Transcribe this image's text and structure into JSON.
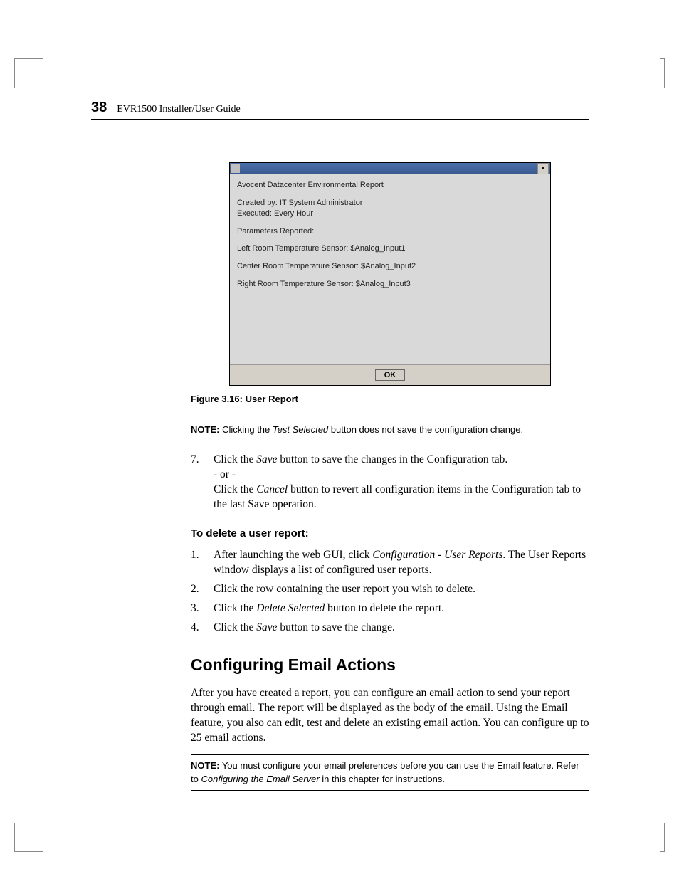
{
  "header": {
    "page_number": "38",
    "doc_title": "EVR1500 Installer/User Guide"
  },
  "figure": {
    "close_glyph": "×",
    "lines": {
      "l1": "Avocent Datacenter Environmental Report",
      "l2": "Created by:  IT System Administrator",
      "l3": "Executed:  Every Hour",
      "l4": "Parameters Reported:",
      "l5": "Left Room Temperature Sensor: $Analog_Input1",
      "l6": "Center Room Temperature Sensor: $Analog_Input2",
      "l7": "Right Room Temperature Sensor: $Analog_Input3"
    },
    "ok_label": "OK",
    "caption": "Figure 3.16: User Report"
  },
  "note1": {
    "label": "NOTE:",
    "before": " Clicking the ",
    "em": "Test Selected",
    "after": " button does not save the configuration change."
  },
  "step7": {
    "num": "7.",
    "a1": "Click the ",
    "a_em": "Save",
    "a2": " button to save the changes in the Configuration tab.",
    "or": "- or -",
    "b1": "Click the ",
    "b_em": "Cancel",
    "b2": " button to revert all configuration items in the Configuration tab to the last Save operation."
  },
  "delete": {
    "heading": "To delete a user report:",
    "s1": {
      "num": "1.",
      "a": "After launching the web GUI, click ",
      "em": "Configuration - User Reports",
      "b": ". The User Reports window displays a list of configured user reports."
    },
    "s2": {
      "num": "2.",
      "a": "Click the row containing the user report you wish to delete."
    },
    "s3": {
      "num": "3.",
      "a": "Click the ",
      "em": "Delete Selected",
      "b": " button to delete the report."
    },
    "s4": {
      "num": "4.",
      "a": "Click the ",
      "em": "Save",
      "b": " button to save the change."
    }
  },
  "section": {
    "heading": "Configuring Email Actions",
    "para": "After you have created a report, you can configure an email action to send your report through email. The report will be displayed as the body of the email. Using the Email feature, you also can edit, test and delete an existing email action. You can configure up to 25 email actions."
  },
  "note2": {
    "label": "NOTE:",
    "before": " You must configure your email preferences before you can use the Email feature. Refer to ",
    "em": "Configuring the Email Server",
    "after": " in this chapter for instructions."
  }
}
